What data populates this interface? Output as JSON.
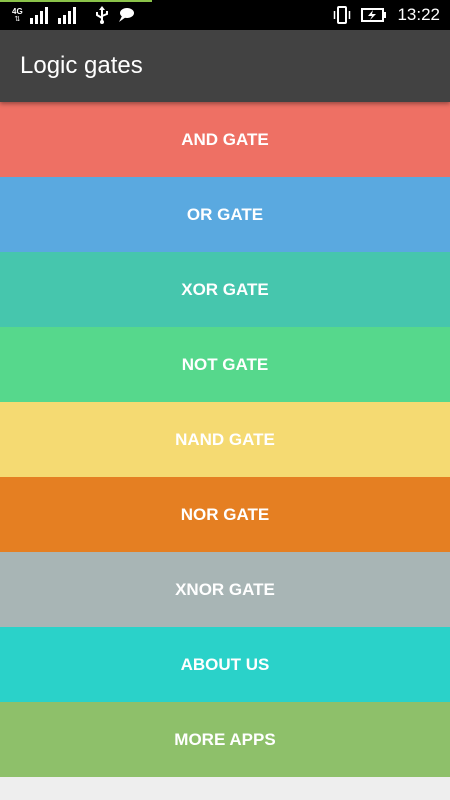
{
  "status_bar": {
    "network_type": "4G",
    "time": "13:22",
    "background": "#000000",
    "accent_color": "#8bc34a",
    "icons": [
      "network-4g-icon",
      "signal-icon",
      "signal-icon",
      "usb-icon",
      "chat-notification-icon",
      "vibrate-icon",
      "battery-charging-icon"
    ]
  },
  "app_bar": {
    "title": "Logic gates",
    "background": "#424242"
  },
  "menu": {
    "items": [
      {
        "label": "AND GATE",
        "color": "#ee7064"
      },
      {
        "label": "OR GATE",
        "color": "#5aa9e0"
      },
      {
        "label": "XOR GATE",
        "color": "#46c6ad"
      },
      {
        "label": "NOT GATE",
        "color": "#56d88c"
      },
      {
        "label": "NAND GATE",
        "color": "#f5da72"
      },
      {
        "label": "NOR GATE",
        "color": "#e57f22"
      },
      {
        "label": "XNOR GATE",
        "color": "#a8b5b5"
      },
      {
        "label": "ABOUT US",
        "color": "#2ad2c9"
      },
      {
        "label": "MORE APPS",
        "color": "#8ec06a"
      }
    ]
  },
  "page_background": "#eeeeee"
}
